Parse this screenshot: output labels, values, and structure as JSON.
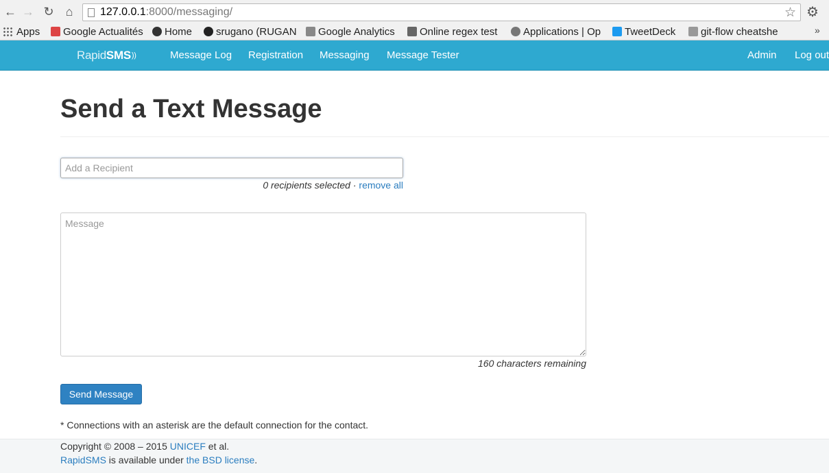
{
  "browser": {
    "url_host": "127.0.0.1",
    "url_rest": ":8000/messaging/",
    "bookmarks": [
      {
        "label": "Apps"
      },
      {
        "label": "Google Actualités",
        "color": "#d44"
      },
      {
        "label": "Home",
        "color": "#333"
      },
      {
        "label": "srugano (RUGAN",
        "color": "#222"
      },
      {
        "label": "Google Analytics",
        "color": "#888"
      },
      {
        "label": "Online regex test",
        "color": "#666"
      },
      {
        "label": "Applications | Op",
        "color": "#777"
      },
      {
        "label": "TweetDeck",
        "color": "#1d9bf0"
      },
      {
        "label": "git-flow cheatshe",
        "color": "#999"
      }
    ],
    "more": "»"
  },
  "navbar": {
    "brand_light": "Rapid",
    "brand_bold": "SMS",
    "links": [
      "Message Log",
      "Registration",
      "Messaging",
      "Message Tester"
    ],
    "admin": "Admin",
    "logout": "Log out",
    "color": "#2ea9d0"
  },
  "main": {
    "title": "Send a Text Message",
    "recipient_placeholder": "Add a Recipient",
    "recipients_selected": "0 recipients selected",
    "separator": "·",
    "remove_all": "remove all",
    "message_placeholder": "Message",
    "chars_remaining": "160 characters remaining",
    "send_label": "Send Message",
    "note": "* Connections with an asterisk are the default connection for the contact."
  },
  "footer": {
    "copyright_prefix": "Copyright © 2008 – 2015 ",
    "unicef": "UNICEF",
    "copyright_suffix": " et al.",
    "rapidsms": "RapidSMS",
    "available": " is available under ",
    "license": "the BSD license",
    "period": "."
  }
}
